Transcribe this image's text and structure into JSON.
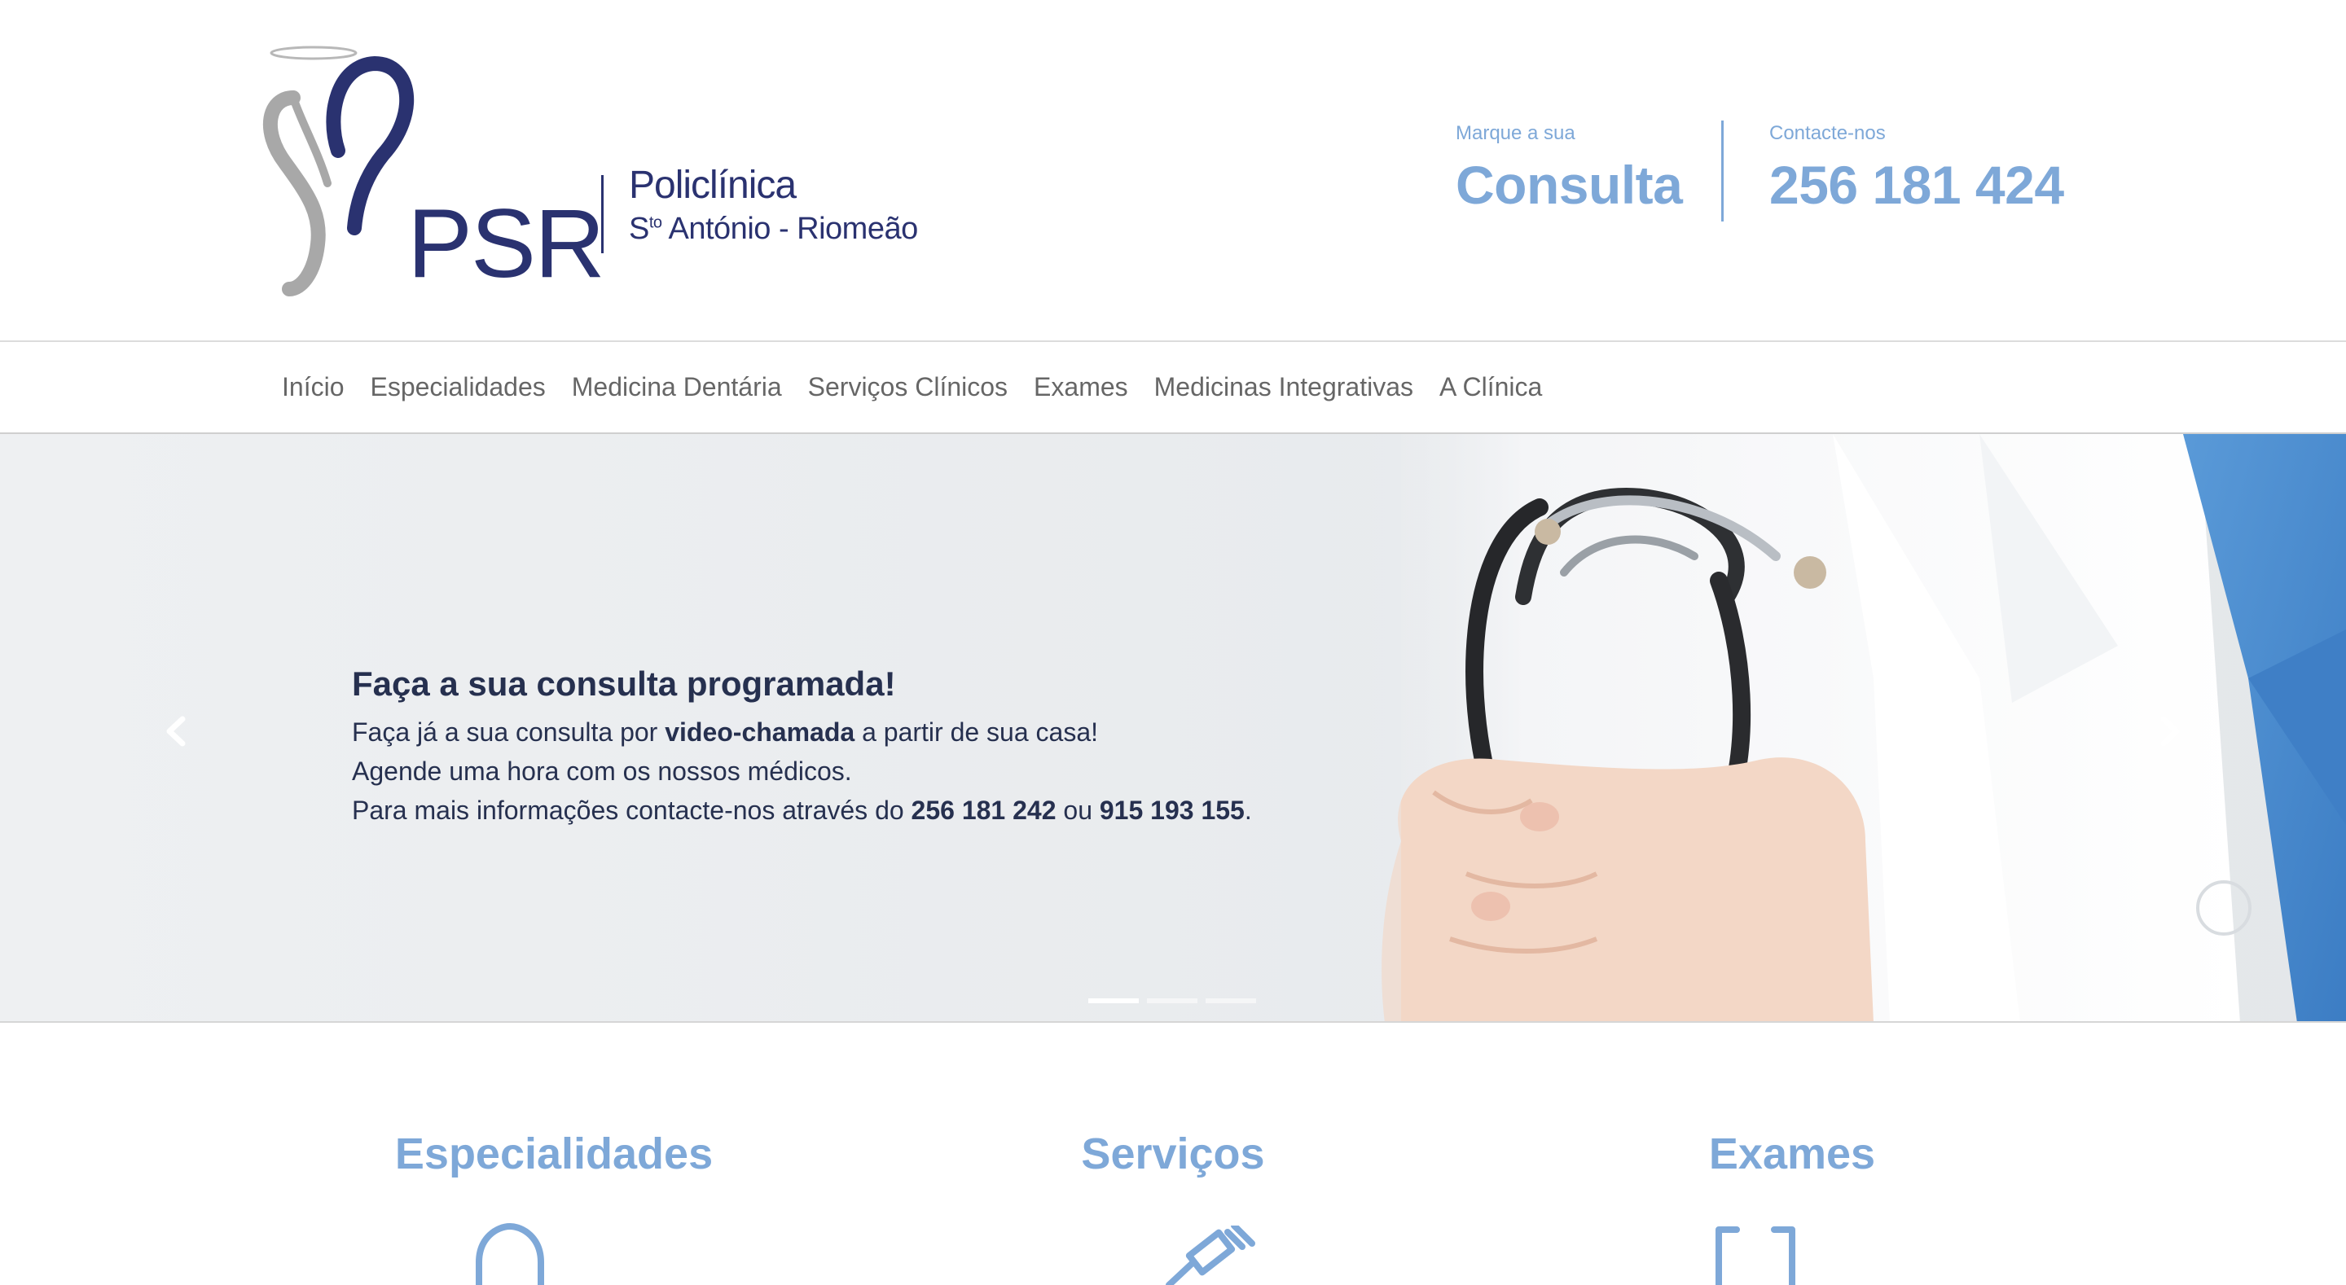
{
  "header": {
    "logo": {
      "brand": "PSR",
      "line1": "Policlínica",
      "line2_prefix": "S",
      "line2_sup": "to",
      "line2_rest": " António - Riomeão"
    },
    "consulta": {
      "small": "Marque a sua",
      "big": "Consulta"
    },
    "phone": {
      "small": "Contacte-nos",
      "big": "256 181 424"
    },
    "accent_color": "#7ea8d8",
    "brand_color": "#2a3270"
  },
  "nav": {
    "items": [
      {
        "label": "Início"
      },
      {
        "label": "Especialidades"
      },
      {
        "label": "Medicina Dentária"
      },
      {
        "label": "Serviços Clínicos"
      },
      {
        "label": "Exames"
      },
      {
        "label": "Medicinas Integrativas"
      },
      {
        "label": "A Clínica"
      }
    ]
  },
  "hero": {
    "title": "Faça a sua consulta programada!",
    "line1_a": "Faça já a sua consulta por ",
    "line1_b": "video-chamada",
    "line1_c": " a partir de sua casa!",
    "line2": "Agende uma hora com os nossos médicos.",
    "line3_a": "Para mais informações contacte-nos através do ",
    "line3_b": "256 181 242",
    "line3_c": " ou ",
    "line3_d": "915 193 155",
    "line3_e": ".",
    "prev_icon": "chevron-left-icon",
    "next_icon": "chevron-right-icon",
    "slides_total": 3,
    "active_slide": 1
  },
  "features": [
    {
      "title": "Especialidades",
      "icon": "stethoscope-icon"
    },
    {
      "title": "Serviços",
      "icon": "syringe-icon"
    },
    {
      "title": "Exames",
      "icon": "scan-icon"
    }
  ]
}
